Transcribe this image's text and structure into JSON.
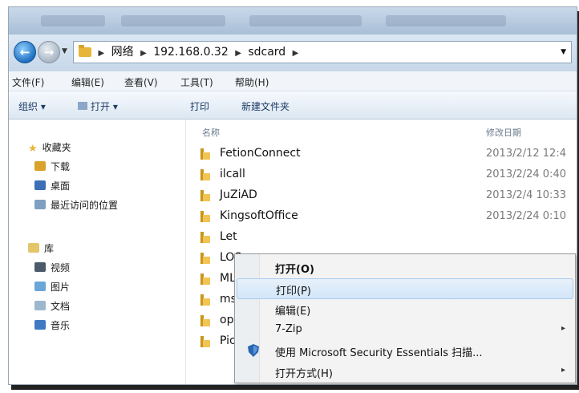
{
  "address_bar": {
    "segments": [
      "网络",
      "192.168.0.32",
      "sdcard"
    ]
  },
  "menubar": {
    "items": [
      "文件(F)",
      "编辑(E)",
      "查看(V)",
      "工具(T)",
      "帮助(H)"
    ]
  },
  "toolbar": {
    "organize": "组织 ▾",
    "open": "打开 ▾",
    "print": "打印",
    "new_folder": "新建文件夹"
  },
  "nav_pane": {
    "favorites": "收藏夹",
    "downloads": "下载",
    "desktop": "桌面",
    "recent": "最近访问的位置",
    "libraries": "库",
    "videos": "视频",
    "pictures": "图片",
    "documents": "文档",
    "music": "音乐"
  },
  "columns": {
    "name": "名称",
    "date_modified": "修改日期"
  },
  "files": [
    {
      "name": "FetionConnect",
      "date": "2013/2/12 12:4"
    },
    {
      "name": "ilcall",
      "date": "2013/2/24 0:40"
    },
    {
      "name": "JuZiAD",
      "date": "2013/2/4 10:33"
    },
    {
      "name": "KingsoftOffice",
      "date": "2013/2/24 0:10"
    },
    {
      "name": "Let",
      "date": ""
    },
    {
      "name": "LOS",
      "date": ""
    },
    {
      "name": "ML",
      "date": ""
    },
    {
      "name": "msl",
      "date": ""
    },
    {
      "name": "opc",
      "date": ""
    },
    {
      "name": "Pict",
      "date": ""
    }
  ],
  "context_menu": {
    "items": [
      {
        "label": "打开(O)",
        "bold": true
      },
      {
        "label": "打印(P)",
        "highlighted": true
      },
      {
        "label": "编辑(E)"
      },
      {
        "label": "7-Zip",
        "submenu": true
      },
      {
        "label": "使用 Microsoft Security Essentials 扫描...",
        "icon": "shield-icon"
      },
      {
        "label": "打开方式(H)",
        "submenu": true
      }
    ]
  },
  "colors": {
    "titlebar": "#a8bfd6",
    "folder": "#e8b53b",
    "menu_highlight": "#d3e6f8"
  }
}
